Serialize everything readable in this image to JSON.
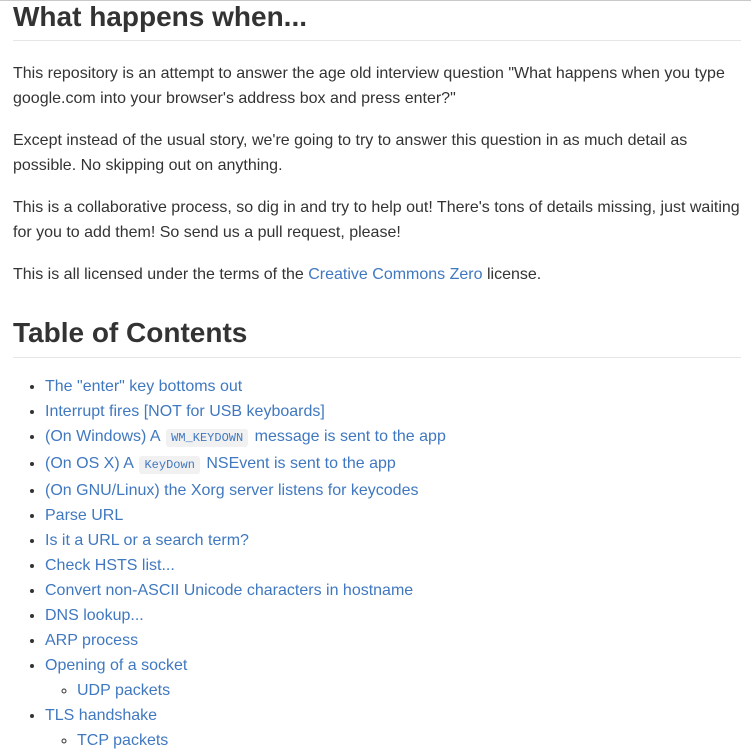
{
  "title": "What happens when...",
  "intro": {
    "p1": "This repository is an attempt to answer the age old interview question \"What happens when you type google.com into your browser's address box and press enter?\"",
    "p2": "Except instead of the usual story, we're going to try to answer this question in as much detail as possible. No skipping out on anything.",
    "p3": "This is a collaborative process, so dig in and try to help out! There's tons of details missing, just waiting for you to add them! So send us a pull request, please!",
    "p4_before": "This is all licensed under the terms of the ",
    "p4_link": "Creative Commons Zero",
    "p4_after": " license."
  },
  "toc": {
    "heading": "Table of Contents",
    "items": [
      {
        "text": "The \"enter\" key bottoms out"
      },
      {
        "text": "Interrupt fires [NOT for USB keyboards]"
      },
      {
        "before": "(On Windows) A ",
        "code": "WM_KEYDOWN",
        "after": " message is sent to the app"
      },
      {
        "before": "(On OS X) A ",
        "code": "KeyDown",
        "after": " NSEvent is sent to the app"
      },
      {
        "text": "(On GNU/Linux) the Xorg server listens for keycodes"
      },
      {
        "text": "Parse URL"
      },
      {
        "text": "Is it a URL or a search term?"
      },
      {
        "text": "Check HSTS list..."
      },
      {
        "text": "Convert non-ASCII Unicode characters in hostname"
      },
      {
        "text": "DNS lookup..."
      },
      {
        "text": "ARP process"
      },
      {
        "text": "Opening of a socket",
        "sub": "UDP packets"
      },
      {
        "text": "TLS handshake",
        "sub": "TCP packets"
      }
    ]
  },
  "colors": {
    "link": "#4078c0",
    "text": "#333333",
    "rule": "#e6e6e6",
    "code_bg": "#f1f1f1"
  }
}
